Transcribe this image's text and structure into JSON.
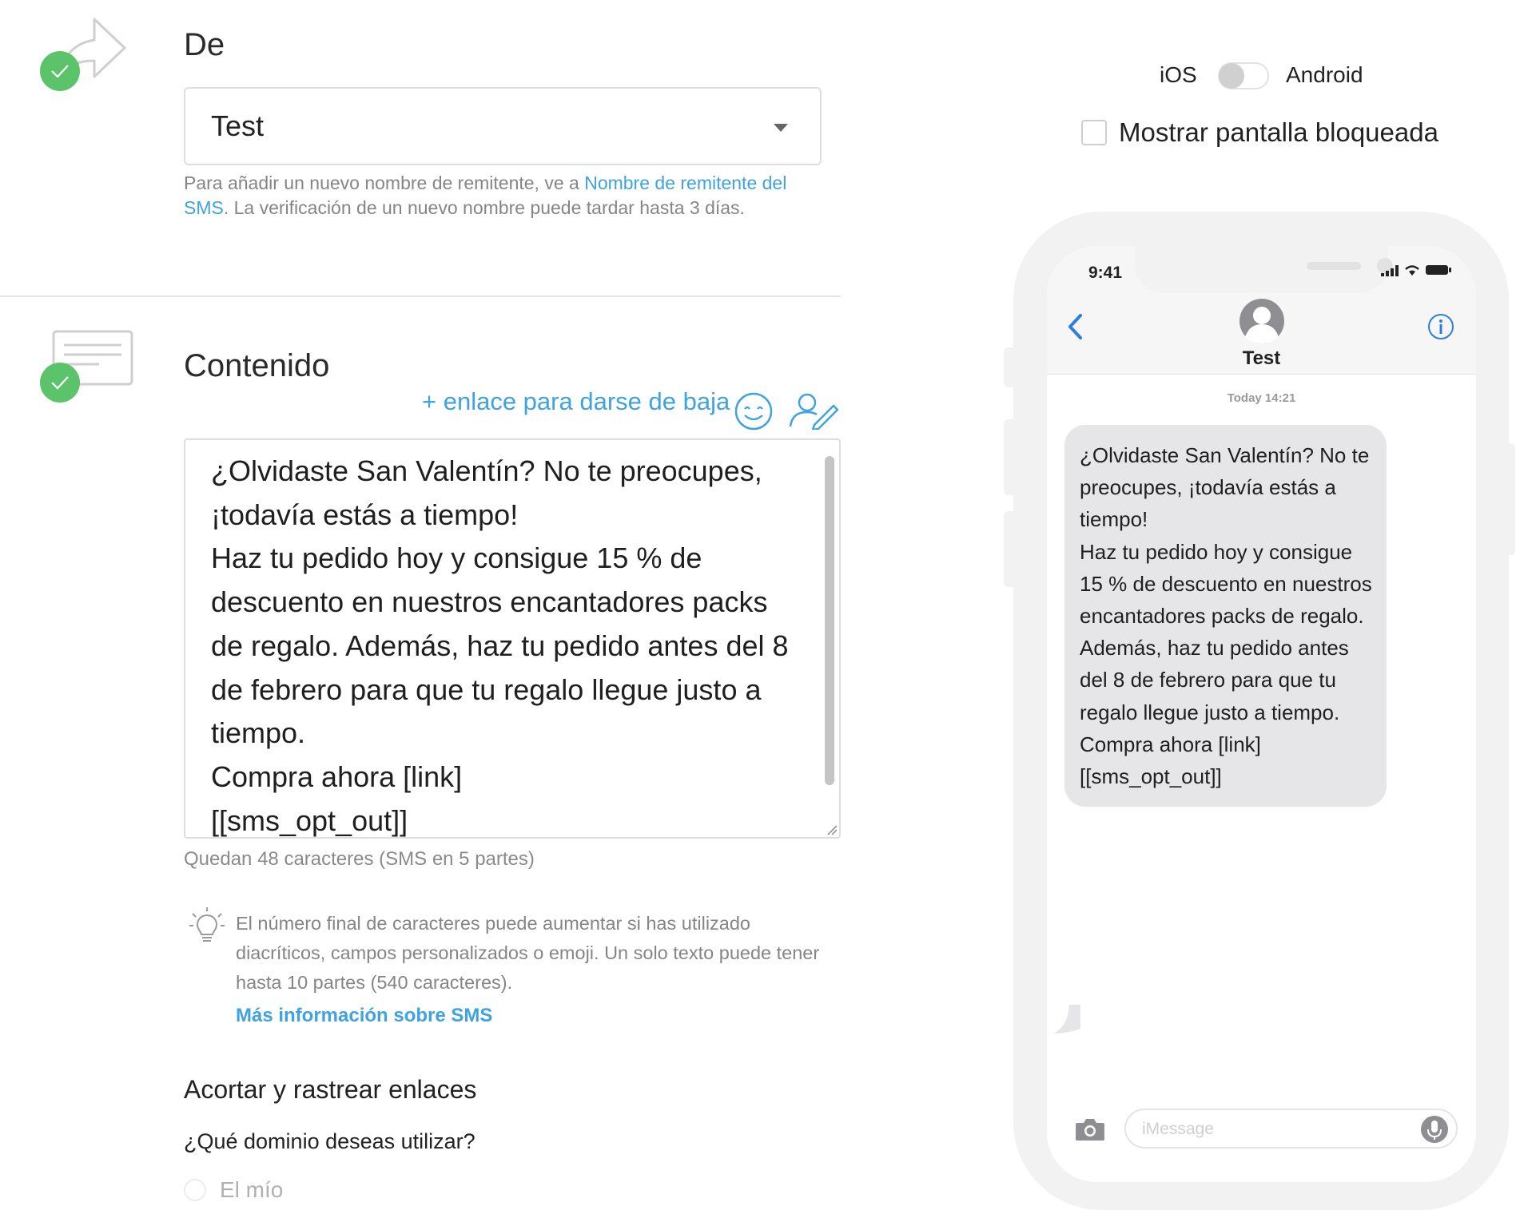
{
  "from_section": {
    "title": "De",
    "sender_value": "Test",
    "help_prefix": "Para añadir un nuevo nombre de remitente, ve a ",
    "help_link": "Nombre de remitente del SMS",
    "help_suffix": ". La verificación de un nuevo nombre puede tardar hasta 3 días."
  },
  "content_section": {
    "title": "Contenido",
    "unsubscribe_link": "+ enlace para darse de baja",
    "message": "¿Olvidaste San Valentín? No te preocupes, ¡todavía estás a tiempo!\nHaz tu pedido hoy y consigue 15 % de descuento en nuestros encantadores packs de regalo. Además, haz tu pedido antes del 8 de febrero para que tu regalo llegue justo a tiempo.\nCompra ahora [link]\n[[sms_opt_out]]",
    "char_count": "Quedan 48 caracteres (SMS en 5 partes)",
    "tip": "El número final de caracteres puede aumentar si has utilizado diacríticos, campos personalizados o emoji. Un solo texto puede tener hasta 10 partes (540 caracteres).",
    "tip_link": "Más información sobre SMS"
  },
  "links_section": {
    "title": "Acortar y rastrear enlaces",
    "question": "¿Qué dominio deseas utilizar?",
    "option_mine": "El mío"
  },
  "preview": {
    "ios_label": "iOS",
    "android_label": "Android",
    "lock_screen_label": "Mostrar pantalla bloqueada",
    "phone": {
      "time": "9:41",
      "contact": "Test",
      "timestamp": "Today 14:21",
      "bubble_text": "¿Olvidaste San Valentín? No te preocupes, ¡todavía estás a tiempo!\nHaz tu pedido hoy y consigue 15 % de descuento en nuestros encantadores packs de regalo. Además, haz tu pedido antes del 8 de febrero para que tu regalo llegue justo a tiempo.\nCompra ahora [link]\n[[sms_opt_out]]",
      "input_placeholder": "iMessage"
    }
  },
  "icons": {
    "from_step": "share-arrow-icon",
    "content_step": "message-card-icon",
    "check": "check-icon",
    "emoji": "smiley-icon",
    "personalize": "user-edit-icon",
    "tip": "lightbulb-icon",
    "back": "chevron-left-icon",
    "info": "info-icon",
    "camera": "camera-icon",
    "mic": "microphone-icon"
  },
  "colors": {
    "accent": "#3ea3e0",
    "success": "#5bc46a",
    "bubble": "#e6e6e9",
    "ios_blue": "#2f7de1"
  }
}
